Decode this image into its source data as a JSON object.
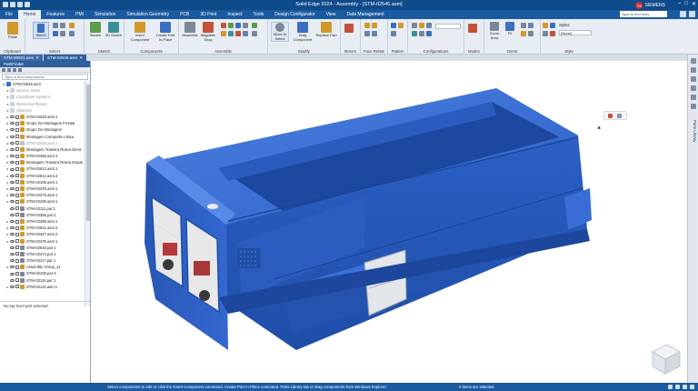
{
  "window": {
    "title": "Solid Edge 2024 - Assembly - [STM-02546.asm]",
    "brand": "SIEMENS",
    "user_initials": "SS",
    "controls": [
      "–",
      "□",
      "✕"
    ]
  },
  "tabs": [
    "File",
    "Home",
    "Features",
    "PMI",
    "Simulation",
    "Simulation Geometry",
    "PCB",
    "3D Print",
    "Inspect",
    "Tools",
    "Design Configurator",
    "View",
    "Data Management"
  ],
  "active_tab": "Home",
  "find_tools_placeholder": "Type to find tools",
  "ribbon": {
    "groups": {
      "clipboard": "Clipboard",
      "select": "Select",
      "sketch": "Sketch",
      "components": "Components",
      "assemble": "Assemble",
      "modify": "Modify",
      "motors": "Motors",
      "face_relate": "Face Relate",
      "pattern": "Pattern",
      "configurations": "Configurations",
      "modes": "Modes",
      "orient": "Orient",
      "style": "Style"
    },
    "buttons": {
      "paste": "Paste",
      "select": "Select",
      "sketch": "Sketch",
      "sketch_3d": "3D Sketch",
      "insert_component": "Insert Component",
      "create_part_in_place": "Create Part In-Place",
      "assemble": "Assemble",
      "magnetic_snap": "Magnetic Snap",
      "move_to_select": "Move to Select",
      "drag_component": "Drag Component",
      "replace_part": "Replace Part",
      "zoom_area": "Zoom Area",
      "fit": "Fit"
    },
    "style_label": "Styles",
    "view_dropdown": "(None)"
  },
  "doc_tabs": [
    {
      "label": "STM-00021.asm",
      "close": "✕"
    },
    {
      "label": "STM-02546.asm",
      "close": "✕"
    }
  ],
  "left_panel": {
    "title": "PathFinder",
    "search_placeholder": "Type to find components",
    "tree": [
      {
        "label": "STM-02546.asm",
        "type": "root"
      },
      {
        "label": "Section Views",
        "type": "dim"
      },
      {
        "label": "Coordinate Systems",
        "type": "dim"
      },
      {
        "label": "Reference Planes",
        "type": "dim"
      },
      {
        "label": "Sketches",
        "type": "dim"
      },
      {
        "label": "STM-02328.asm:1",
        "type": "asm"
      },
      {
        "label": "Grupo De Montagem Frontal",
        "type": "asm"
      },
      {
        "label": "Grupo De Montagem",
        "type": "asm"
      },
      {
        "label": "Montagem Comporta e Bica",
        "type": "asm"
      },
      {
        "label": "STM-02403.asm:1",
        "type": "dimasm"
      },
      {
        "label": "Montagem Traseira Rosca Direit",
        "type": "asm"
      },
      {
        "label": "STM-02368.asm:1",
        "type": "asm"
      },
      {
        "label": "Montagem Traseira Rosca Esque",
        "type": "asm"
      },
      {
        "label": "STM-02612.asm:1",
        "type": "asm"
      },
      {
        "label": "STM-02612.asm:2",
        "type": "asm"
      },
      {
        "label": "STM-02105.asm:1",
        "type": "asm"
      },
      {
        "label": "STM-02376.asm:1",
        "type": "asm"
      },
      {
        "label": "STM-02375.asm:1",
        "type": "asm"
      },
      {
        "label": "STM-02109.asm:1",
        "type": "asm"
      },
      {
        "label": "STM-02111.par:1",
        "type": "part"
      },
      {
        "label": "STM-02356.par:2",
        "type": "part"
      },
      {
        "label": "STM-02398.asm:1",
        "type": "asm"
      },
      {
        "label": "STM-02541.asm:2",
        "type": "asm"
      },
      {
        "label": "STM-02327.asm:2",
        "type": "asm"
      },
      {
        "label": "STM-02475.asm:1",
        "type": "asm"
      },
      {
        "label": "STM-02515.par:1",
        "type": "part"
      },
      {
        "label": "STM-02474.par:1",
        "type": "part"
      },
      {
        "label": "STM-02117.par:1",
        "type": "part"
      },
      {
        "label": "Assembly Group_11",
        "type": "asm"
      },
      {
        "label": "STM-02108.par:3",
        "type": "part"
      },
      {
        "label": "STM-02118.par:1",
        "type": "part"
      },
      {
        "label": "STM-02115.asm:1",
        "type": "asm"
      }
    ],
    "status": "No top level part selected."
  },
  "right_strip": {
    "label": "Parts Library"
  },
  "statusbar": {
    "message": "Select components to edit or click the Insert Component command, Create Part In-Place command, Parts Library tab or drag components from Windows Explorer.",
    "selection": "0 items are selected"
  },
  "colors": {
    "model_blue": "#2f62c9",
    "title_bar": "#0f4a8a",
    "tab_bar": "#1a5aa0",
    "ribbon_bg": "#e8edf3"
  }
}
